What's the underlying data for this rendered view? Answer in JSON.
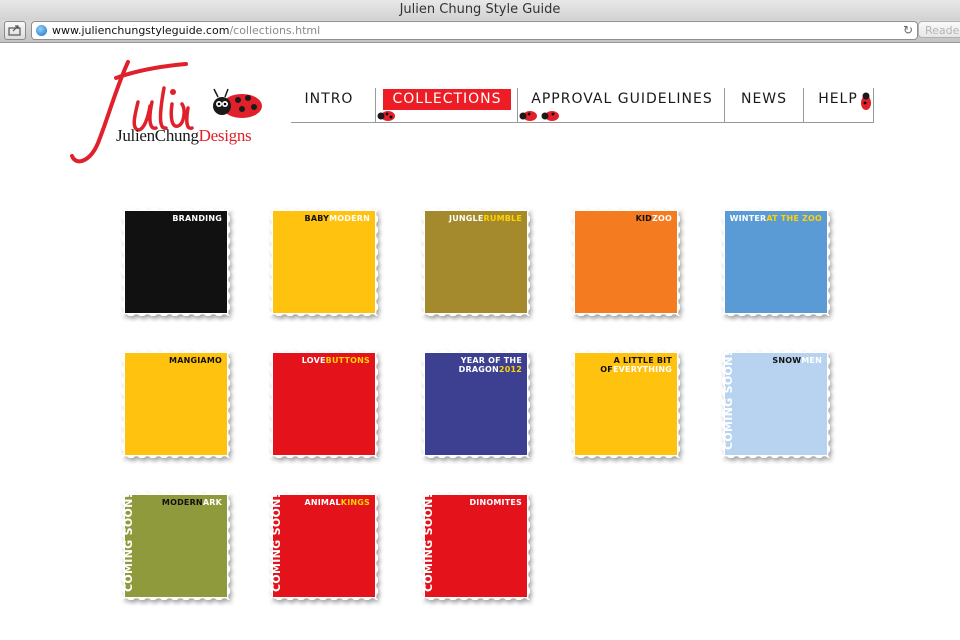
{
  "window": {
    "title": "Julien Chung Style Guide"
  },
  "browser": {
    "url_host": "www.julienchungstyleguide.com",
    "url_path": "/collections.html",
    "reader_label": "Reader"
  },
  "logo": {
    "script": "Julien",
    "name_part1": "JulienChung",
    "name_part2": "Designs"
  },
  "nav": [
    {
      "label": "INTRO",
      "active": false
    },
    {
      "label": "COLLECTIONS",
      "active": true
    },
    {
      "label": "APPROVAL GUIDELINES",
      "active": false
    },
    {
      "label": "NEWS",
      "active": false
    },
    {
      "label": "HELP",
      "active": false
    }
  ],
  "collections": [
    {
      "title_a": "BRANDING",
      "title_b": "",
      "bg": "#111111",
      "coming": ""
    },
    {
      "title_a": "BABY",
      "title_b": "MODERN",
      "bg": "#ffc20e",
      "coming": ""
    },
    {
      "title_a": "JUNGLE",
      "title_b": "RUMBLE",
      "bg": "#a48a2c",
      "coming": ""
    },
    {
      "title_a": "KID",
      "title_b": "ZOO",
      "bg": "#f47b20",
      "coming": ""
    },
    {
      "title_a": "WINTER",
      "title_b": "AT THE ZOO",
      "bg": "#5b9bd5",
      "coming": ""
    },
    {
      "title_a": "MANGIAMO",
      "title_b": "",
      "bg": "#ffc20e",
      "coming": ""
    },
    {
      "title_a": "LOVE",
      "title_b": "BUTTONS",
      "bg": "#e3121b",
      "coming": ""
    },
    {
      "title_a": "YEAR OF THE DRAGON",
      "title_b": "2012",
      "bg": "#3d3f91",
      "coming": ""
    },
    {
      "title_a": "A LITTLE BIT OF",
      "title_b": "EVERYTHING",
      "bg": "#ffc20e",
      "coming": ""
    },
    {
      "title_a": "SNOW",
      "title_b": "MEN",
      "bg": "#b8d3ef",
      "coming": "COMING SOON!"
    },
    {
      "title_a": "MODERN",
      "title_b": "ARK",
      "bg": "#8f9a3c",
      "coming": "COMING SOON!"
    },
    {
      "title_a": "ANIMAL",
      "title_b": "KINGS",
      "bg": "#e3121b",
      "coming": "COMING SOON!"
    },
    {
      "title_a": "DINOMITES",
      "title_b": "",
      "bg": "#e3121b",
      "coming": "COMING SOON!"
    }
  ]
}
